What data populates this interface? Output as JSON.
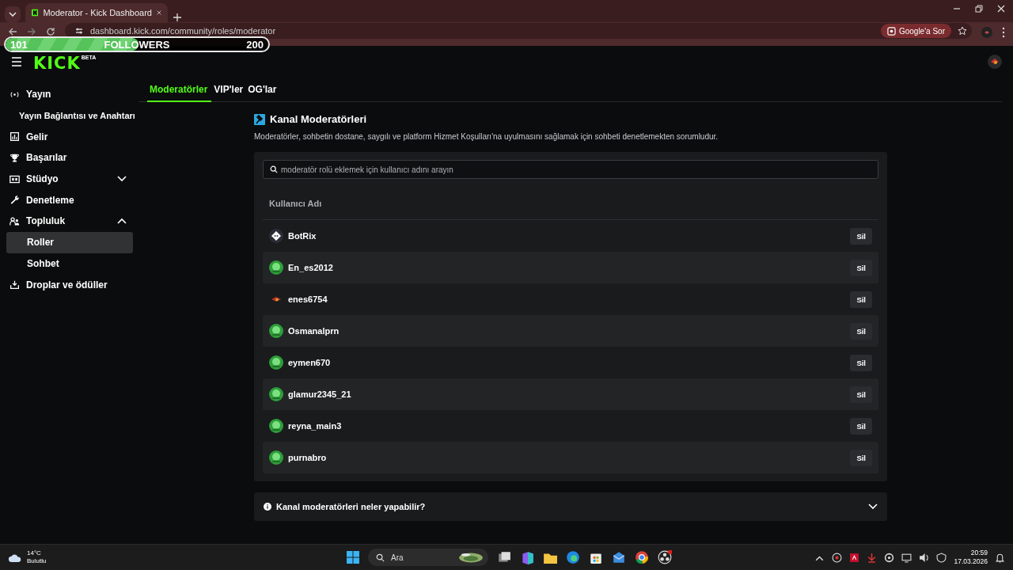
{
  "browser": {
    "tab_title": "Moderator - Kick Dashboard",
    "url": "dashboard.kick.com/community/roles/moderator",
    "ask_button": "Google'a Sor"
  },
  "followers_goal": {
    "current": "101",
    "label": "FOLLOWERS",
    "target": "200",
    "level": 0.505
  },
  "header": {
    "logo": "KICK",
    "badge": "BETA"
  },
  "sidebar": [
    {
      "label": "Yayın",
      "kind": "item",
      "selected": false
    },
    {
      "label": "Yayın Bağlantısı ve Anahtarı",
      "kind": "subitem",
      "selected": false
    },
    {
      "label": "Gelir",
      "kind": "item",
      "selected": false
    },
    {
      "label": "Başarılar",
      "kind": "item",
      "selected": false
    },
    {
      "label": "Stüdyo",
      "kind": "group",
      "selected": false,
      "expanded": false
    },
    {
      "label": "Denetleme",
      "kind": "item",
      "selected": false
    },
    {
      "label": "Topluluk",
      "kind": "group",
      "selected": false,
      "expanded": true,
      "children": [
        {
          "label": "Roller",
          "selected": true
        },
        {
          "label": "Sohbet",
          "selected": false
        }
      ]
    },
    {
      "label": "Droplar ve ödüller",
      "kind": "item",
      "selected": false
    }
  ],
  "tabs": [
    {
      "label": "Moderatörler",
      "selected": true
    },
    {
      "label": "VIP'ler",
      "selected": false
    },
    {
      "label": "OG'lar",
      "selected": false
    }
  ],
  "section": {
    "title": "Kanal Moderatörleri",
    "description": "Moderatörler, sohbetin dostane, saygılı ve platform Hizmet Koşulları'na uyulmasını sağlamak için sohbeti denetlemekten sorumludur.",
    "search_placeholder": "moderatör rolü eklemek için kullanıcı adını arayın",
    "column": "Kullanıcı Adı",
    "rows": [
      {
        "name": "BotRix",
        "kind": "bot",
        "action": "Sil"
      },
      {
        "name": "En_es2012",
        "kind": "green",
        "action": "Sil"
      },
      {
        "name": "enes6754",
        "kind": "dark",
        "action": "Sil"
      },
      {
        "name": "Osmanalprn",
        "kind": "green",
        "action": "Sil"
      },
      {
        "name": "eymen670",
        "kind": "green",
        "action": "Sil"
      },
      {
        "name": "glamur2345_21",
        "kind": "green",
        "action": "Sil"
      },
      {
        "name": "reyna_main3",
        "kind": "green",
        "action": "Sil"
      },
      {
        "name": "purnabro",
        "kind": "green",
        "action": "Sil"
      }
    ],
    "faq": {
      "title": "Kanal moderatörleri neler yapabilir?",
      "expanded": false
    }
  },
  "taskbar": {
    "temperature": "14°C",
    "weather": "Bulutlu",
    "search": "Ara",
    "time": "20:59",
    "date": "17.03.2026"
  }
}
